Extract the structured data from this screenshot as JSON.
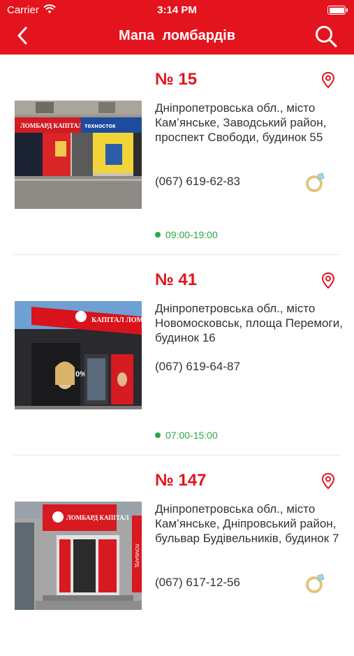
{
  "status_bar": {
    "carrier": "Carrier",
    "time": "3:14 PM"
  },
  "nav": {
    "title": "Мапа  ломбардів",
    "back_icon": "chevron-left-icon",
    "search_icon": "search-icon"
  },
  "colors": {
    "brand": "#e3141d",
    "open_status": "#2aa845",
    "text": "#333333"
  },
  "branches": [
    {
      "number": "№ 15",
      "address": "Дніпропетровська обл., місто Кам’янське, Заводський район, проспект Свободи, будинок 55",
      "phone": "(067) 619-62-83",
      "hours": "09:00-19:00",
      "has_jewelry_icon": true,
      "photo_signs": [
        "ЛОМБАРД КАПІТАЛ",
        "техносток"
      ]
    },
    {
      "number": "№ 41",
      "address": "Дніпропетровська обл., місто Новомосковськ, площа Перемоги, будинок 16",
      "phone": "(067) 619-64-87",
      "hours": "07:00-15:00",
      "has_jewelry_icon": false,
      "photo_signs": [
        "КАПІТАЛ ЛОМБАРД",
        "0%"
      ]
    },
    {
      "number": "№ 147",
      "address": "Дніпропетровська обл., місто Кам’янське, Дніпровський район, бульвар Будівельників, будинок 7",
      "phone": "(067) 617-12-56",
      "hours": "",
      "has_jewelry_icon": true,
      "photo_signs": [
        "ЛОМБАРД КАПІТАЛ",
        "ЛОМБАРД"
      ]
    }
  ]
}
